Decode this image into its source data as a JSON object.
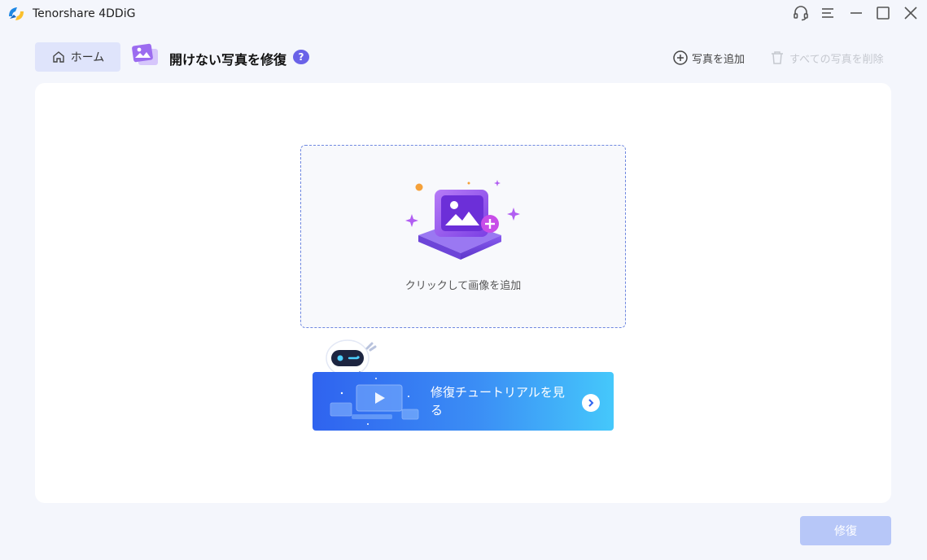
{
  "app": {
    "title": "Tenorshare 4DDiG",
    "logo_icon": "4ddig-logo-icon"
  },
  "window_controls": {
    "icons": [
      "headset-icon",
      "menu-icon",
      "minimize-icon",
      "maximize-icon",
      "close-icon"
    ]
  },
  "toolbar": {
    "home_label": "ホーム",
    "page_title": "開けない写真を修復",
    "help_label": "?",
    "add_photo_label": "写真を追加",
    "delete_all_label": "すべての写真を削除"
  },
  "drop_zone": {
    "label": "クリックして画像を追加"
  },
  "tutorial": {
    "text": "修復チュートリアルを見る"
  },
  "actions": {
    "repair_label": "修復",
    "repair_enabled": false
  },
  "colors": {
    "accent": "#3b5bdb",
    "help_badge": "#6a62e8",
    "banner_start": "#2f63ef",
    "banner_end": "#45c8fb",
    "repair_disabled": "#b7c7f8"
  }
}
